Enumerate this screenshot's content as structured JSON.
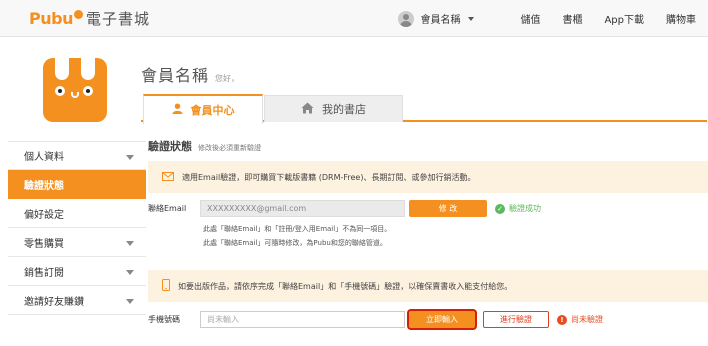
{
  "header": {
    "logo_brand": "Pubu",
    "logo_text": "電子書城",
    "user_name": "會員名稱",
    "nav": [
      "儲值",
      "書櫃",
      "App下載",
      "購物車"
    ]
  },
  "sidebar": {
    "items": [
      {
        "label": "個人資料",
        "expandable": true
      },
      {
        "label": "驗證狀態",
        "expandable": false,
        "active": true
      },
      {
        "label": "偏好設定",
        "expandable": false
      },
      {
        "label": "零售購買",
        "expandable": true
      },
      {
        "label": "銷售訂閱",
        "expandable": true
      },
      {
        "label": "邀請好友賺鑽",
        "expandable": true
      }
    ]
  },
  "main": {
    "member_name": "會員名稱",
    "greeting": "您好，",
    "tabs": [
      {
        "label": "會員中心",
        "icon": "user-icon",
        "active": true
      },
      {
        "label": "我的書店",
        "icon": "home-icon",
        "active": false
      }
    ],
    "section_title": "驗證狀態",
    "section_subtitle": "修改後必須重新驗證",
    "email_notice": "適用Email驗證，即可購買下載版書籍 (DRM-Free)、長期訂閱、或參加行銷活動。",
    "email_label": "聯絡Email",
    "email_value": "XXXXXXXXX@gmail.com",
    "email_button": "修 改",
    "email_status": "驗證成功",
    "email_note1": "此處「聯絡Email」和「註冊/登入用Email」不為同一項目。",
    "email_note2": "此處「聯絡Email」可隨時修改，為Pubu和您的聯絡管道。",
    "phone_notice": "如要出版作品，請依序完成「聯絡Email」和「手機號碼」驗證，以確保賣書收入能支付給您。",
    "phone_label": "手機號碼",
    "phone_placeholder": "尚未輸入",
    "phone_button": "立即輸入",
    "verify_button": "進行驗證",
    "phone_status": "尚未驗證"
  },
  "colors": {
    "accent": "#f39020",
    "notice_bg": "#fdf1df",
    "success": "#5cb85c",
    "warning": "#e84c1e"
  }
}
